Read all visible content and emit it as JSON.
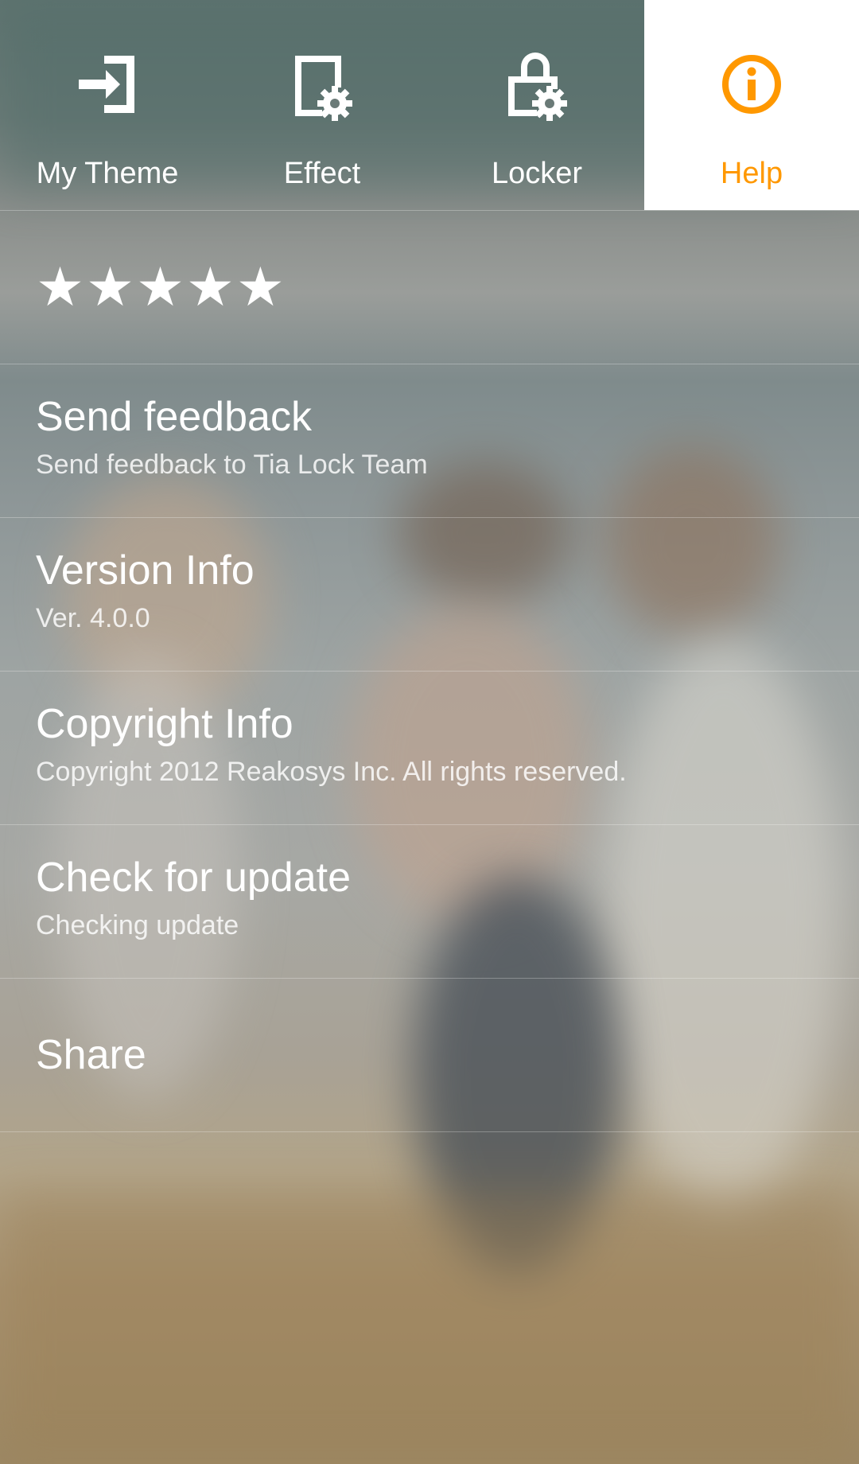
{
  "tabs": [
    {
      "label": "My Theme",
      "icon": "enter-box-icon",
      "active": false
    },
    {
      "label": "Effect",
      "icon": "document-gear-icon",
      "active": false
    },
    {
      "label": "Locker",
      "icon": "lock-gear-icon",
      "active": false
    },
    {
      "label": "Help",
      "icon": "info-icon",
      "active": true
    }
  ],
  "rating": {
    "stars": "★★★★★",
    "value": 5,
    "max": 5
  },
  "items": [
    {
      "title": "Send feedback",
      "subtitle": "Send feedback to Tia Lock Team"
    },
    {
      "title": "Version Info",
      "subtitle": "Ver. 4.0.0"
    },
    {
      "title": "Copyright Info",
      "subtitle": "Copyright 2012 Reakosys Inc. All rights reserved."
    },
    {
      "title": "Check for update",
      "subtitle": "Checking update"
    },
    {
      "title": "Share"
    }
  ],
  "colors": {
    "accent": "#ff9800",
    "text": "#ffffff",
    "active_tab_bg": "#ffffff"
  }
}
